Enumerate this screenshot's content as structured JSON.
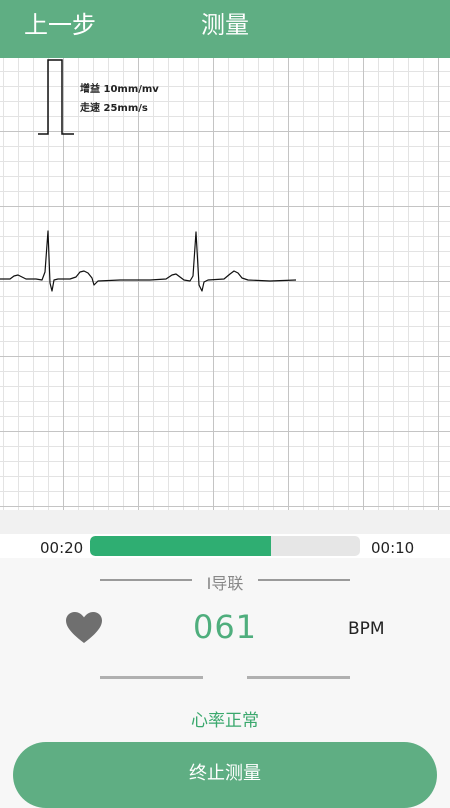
{
  "header": {
    "back_label": "上一步",
    "title": "测量"
  },
  "ecg": {
    "gain_label": "增益 10mm/mv",
    "speed_label": "走速 25mm/s"
  },
  "progress": {
    "elapsed": "00:20",
    "remaining": "00:10",
    "fraction": 0.67,
    "color": "#2fae72"
  },
  "lead": {
    "label": "I导联"
  },
  "heart_rate": {
    "icon": "heart-icon",
    "value": "061",
    "unit": "BPM",
    "status": "心率正常"
  },
  "actions": {
    "stop_label": "终止测量"
  },
  "colors": {
    "brand": "#5fae83",
    "value_green": "#4fae7d"
  }
}
